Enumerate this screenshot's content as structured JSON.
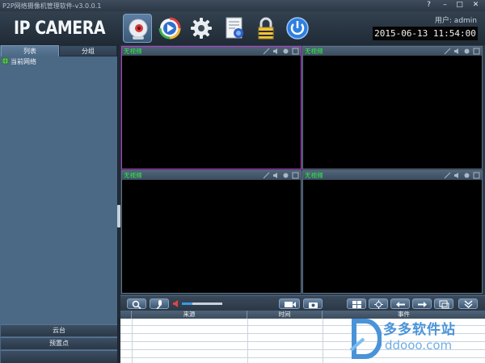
{
  "window": {
    "title": "P2P网络摄像机管理软件-v3.0.0.1",
    "controls": [
      "?",
      "–",
      "□",
      "✕"
    ]
  },
  "header": {
    "app_title": "IP CAMERA",
    "user_label": "用户: admin",
    "datetime": "2015-06-13 11:54:00",
    "tools": [
      {
        "icon": "camera-icon",
        "active": true
      },
      {
        "icon": "playback-icon",
        "active": false
      },
      {
        "icon": "gear-icon",
        "active": false
      },
      {
        "icon": "log-document-icon",
        "active": false
      },
      {
        "icon": "lock-icon",
        "active": false
      },
      {
        "icon": "power-icon",
        "active": false
      }
    ]
  },
  "sidebar": {
    "tabs": [
      {
        "label": "列表",
        "active": true
      },
      {
        "label": "分组",
        "active": false
      }
    ],
    "tree_root": "当前网络",
    "bottom_buttons": [
      "云台",
      "预置点"
    ]
  },
  "video": {
    "cells": [
      {
        "label": "无视频",
        "selected": true
      },
      {
        "label": "无视频",
        "selected": false
      },
      {
        "label": "无视频",
        "selected": false
      },
      {
        "label": "无视频",
        "selected": false
      }
    ],
    "label_color": "#34f24c",
    "selected_border": "#b93cc7"
  },
  "toolbar": {
    "volume_level": 0.25,
    "buttons": [
      "search-icon",
      "mic-icon",
      "record-icon",
      "snapshot-icon",
      "grid-layout-icon",
      "ptz-icon",
      "prev-icon",
      "next-icon",
      "fullscreen-icon",
      "collapse-icon"
    ]
  },
  "events": {
    "columns": [
      "来源",
      "时间",
      "事件"
    ]
  },
  "watermark": {
    "text": "多多软件站",
    "url": "ddooo.com"
  }
}
